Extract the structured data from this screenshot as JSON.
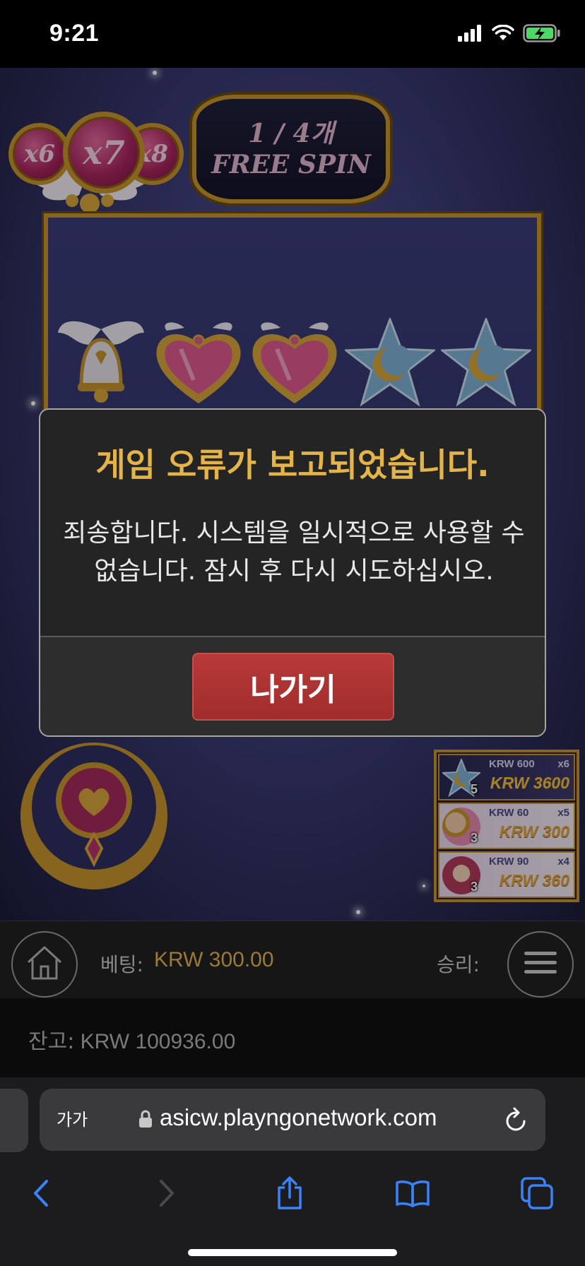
{
  "status_bar": {
    "time": "9:21",
    "icons": [
      "cellular-signal-icon",
      "wifi-icon",
      "battery-charging-icon"
    ],
    "battery_color": "#4cd964"
  },
  "game": {
    "multipliers": [
      "x6",
      "x7",
      "x8"
    ],
    "free_spin_text": "1 / 4개 FREE SPIN",
    "symbols": [
      "bell-icon",
      "heart-icon",
      "heart-icon",
      "star-moon-icon",
      "star-moon-icon"
    ],
    "paytable": [
      {
        "count": "5",
        "label": "KRW 600",
        "multiplier": "x6",
        "amount": "KRW 3600"
      },
      {
        "count": "3",
        "label": "KRW 60",
        "multiplier": "x5",
        "amount": "KRW 300"
      },
      {
        "count": "3",
        "label": "KRW 90",
        "multiplier": "x4",
        "amount": "KRW 360"
      }
    ]
  },
  "dialog": {
    "title": "게임 오류가 보고되었습니다.",
    "message": "죄송합니다. 시스템을 일시적으로 사용할 수 없습니다. 잠시 후 다시 시도하십시오.",
    "exit_label": "나가기",
    "title_color": "#e4b449",
    "button_color": "#b03535"
  },
  "controls": {
    "bet_label": "베팅:",
    "bet_value": "KRW 300.00",
    "win_label": "승리:",
    "balance_label": "잔고:",
    "balance_value": "KRW 100936.00"
  },
  "browser": {
    "text_size_label": "가가",
    "url": "asicw.playngonetwork.com",
    "accent_color": "#3a82f7"
  }
}
